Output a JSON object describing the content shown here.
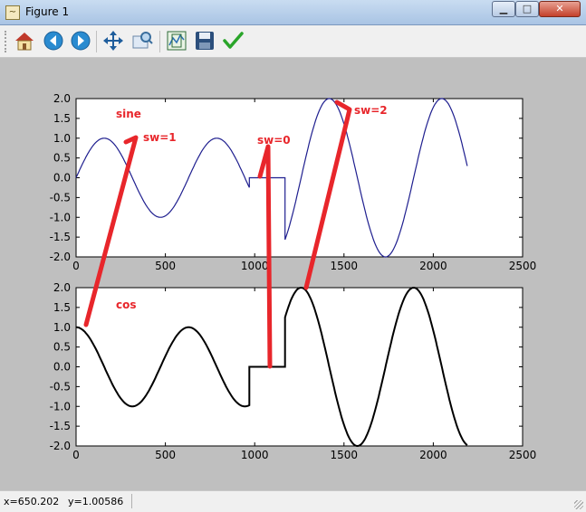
{
  "window": {
    "title": "Figure 1",
    "app_icon": "matplotlib-icon",
    "controls": [
      "minimize-icon",
      "maximize-icon",
      "close-icon"
    ]
  },
  "toolbar": {
    "buttons": [
      "home-icon",
      "back-icon",
      "forward-icon",
      "pan-icon",
      "zoom-icon",
      "configure-subplots-icon",
      "save-icon",
      "edit-axis-icon"
    ]
  },
  "status": {
    "x_readout": "x=650.202",
    "y_readout": "y=1.00586"
  },
  "colors": {
    "sine_line": "#1f1f8f",
    "cos_line": "#000000",
    "annotation": "#e8262b",
    "figure_bg": "#bfbfbf"
  },
  "annotations": {
    "sine_label": "sine",
    "cos_label": "cos",
    "sw1": "sw=1",
    "sw0": "sw=0",
    "sw2": "sw=2"
  },
  "chart_data": [
    {
      "type": "line",
      "label": "sine",
      "xlim": [
        0,
        2500
      ],
      "ylim": [
        -2.0,
        2.0
      ],
      "xticks": [
        "0",
        "500",
        "1000",
        "1500",
        "2000",
        "2500"
      ],
      "yticks": [
        "2.0",
        "1.5",
        "1.0",
        "0.5",
        "0.0",
        "-0.5",
        "-1.0",
        "-1.5",
        "-2.0"
      ],
      "segments": [
        {
          "x_start": 0,
          "x_end": 970,
          "function": "sin",
          "amplitude": 1,
          "period": 630
        },
        {
          "x_start": 970,
          "x_end": 1170,
          "constant": 0
        },
        {
          "x_start": 1170,
          "x_end": 2190,
          "function": "sin",
          "amplitude": 2,
          "period": 630
        }
      ]
    },
    {
      "type": "line",
      "label": "cos",
      "xlim": [
        0,
        2500
      ],
      "ylim": [
        -2.0,
        2.0
      ],
      "xticks": [
        "0",
        "500",
        "1000",
        "1500",
        "2000",
        "2500"
      ],
      "yticks": [
        "2.0",
        "1.5",
        "1.0",
        "0.5",
        "0.0",
        "-0.5",
        "-1.0",
        "-1.5",
        "-2.0"
      ],
      "segments": [
        {
          "x_start": 0,
          "x_end": 970,
          "function": "cos",
          "amplitude": 1,
          "period": 630
        },
        {
          "x_start": 970,
          "x_end": 1170,
          "constant": 0
        },
        {
          "x_start": 1170,
          "x_end": 2190,
          "function": "cos",
          "amplitude": 2,
          "period": 630
        }
      ]
    }
  ]
}
